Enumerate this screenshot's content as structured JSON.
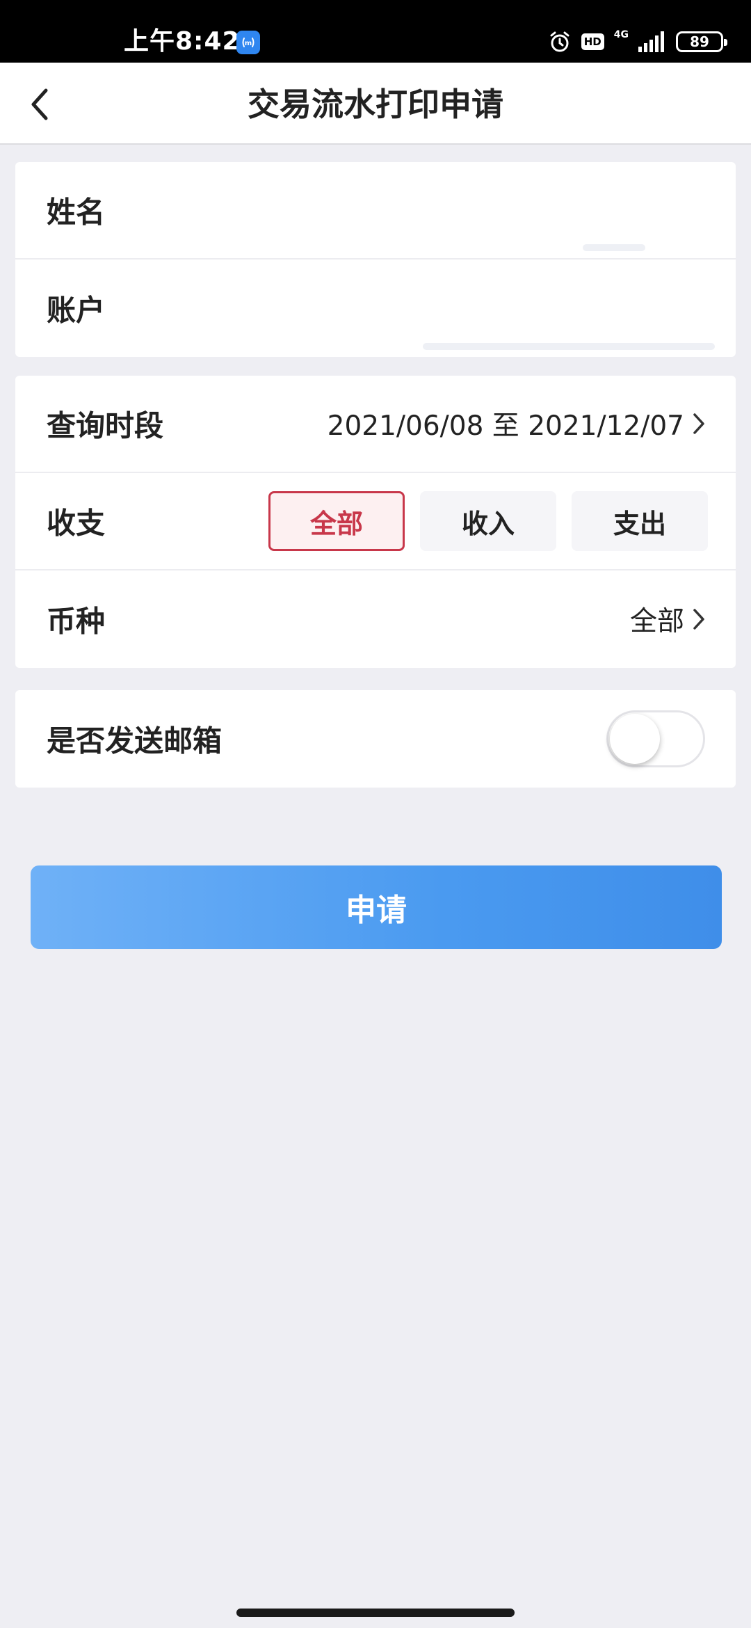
{
  "status_bar": {
    "time": "上午8:42",
    "hd": "HD",
    "network": "4G",
    "battery": "89"
  },
  "header": {
    "title": "交易流水打印申请",
    "back_icon": "chevron-left-icon"
  },
  "account_info": {
    "name_label": "姓名",
    "account_label": "账户"
  },
  "query": {
    "period_label": "查询时段",
    "period_value": "2021/06/08 至 2021/12/07",
    "direction_label": "收支",
    "direction_options": [
      "全部",
      "收入",
      "支出"
    ],
    "direction_selected": "全部",
    "currency_label": "币种",
    "currency_value": "全部"
  },
  "email": {
    "label": "是否发送邮箱",
    "enabled": false
  },
  "apply_button": "申请",
  "colors": {
    "accent_red": "#c8374a",
    "button_blue": "#4a9af0",
    "background": "#eeeef3"
  }
}
